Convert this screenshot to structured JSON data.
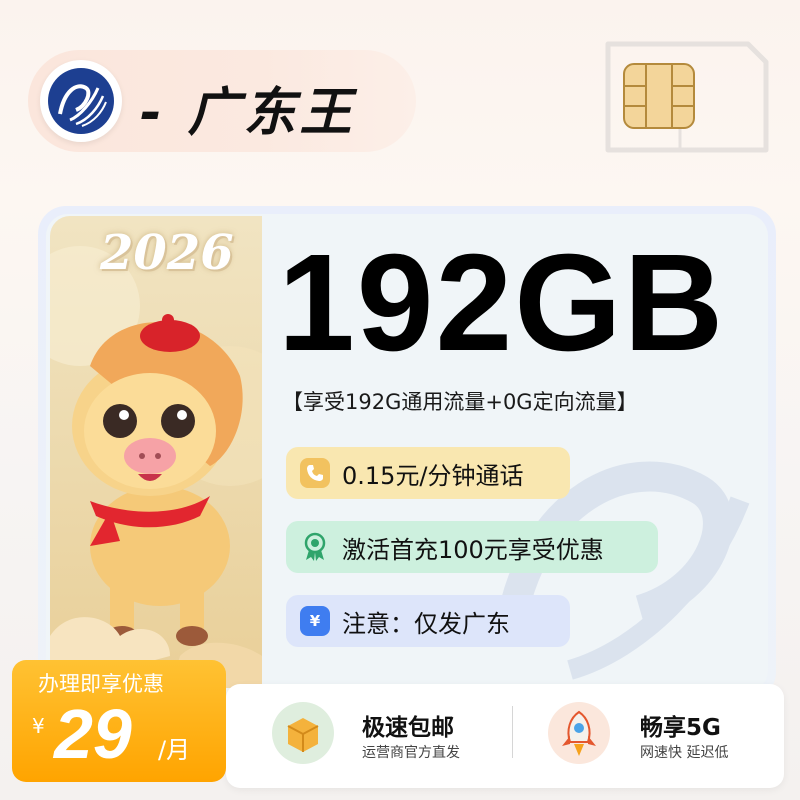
{
  "header": {
    "brand_title": "- 广东王",
    "logo_icon": "carrier-logo-icon",
    "sim_icon": "sim-card-icon"
  },
  "plan": {
    "year_badge": "2026",
    "data_amount": "192GB",
    "data_description": "【享受192G通用流量+0G定向流量】"
  },
  "features": [
    {
      "icon": "phone-icon",
      "text": "0.15元/分钟通话",
      "color": "#f9e7b0"
    },
    {
      "icon": "award-ribbon-icon",
      "text": "激活首充100元享受优惠",
      "color": "#cdf0de"
    },
    {
      "icon": "ticket-icon",
      "text": "注意：仅发广东",
      "color": "#dde5fa"
    }
  ],
  "price": {
    "label": "办理即享优惠",
    "currency": "¥",
    "value": "29",
    "unit": "/月"
  },
  "perks": [
    {
      "icon": "package-box-icon",
      "title": "极速包邮",
      "subtitle": "运营商官方直发"
    },
    {
      "icon": "rocket-icon",
      "title": "畅享5G",
      "subtitle": "网速快 延迟低"
    }
  ],
  "colors": {
    "price_orange": "#ffa400",
    "call_bg": "#f9e7b0",
    "activate_bg": "#cdf0de",
    "note_bg": "#dde5fa",
    "brand_blue": "#1f3a8a"
  }
}
